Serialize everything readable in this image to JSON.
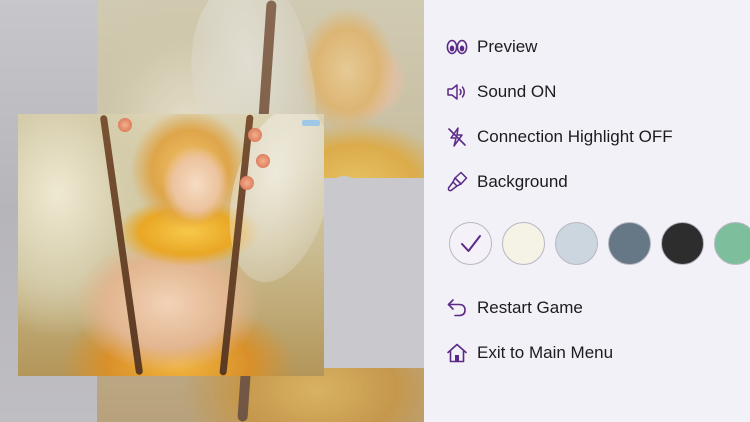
{
  "menu": {
    "preview_label": "Preview",
    "sound_label": "Sound ON",
    "highlight_label": "Connection Highlight OFF",
    "background_label": "Background",
    "restart_label": "Restart Game",
    "exit_label": "Exit to Main Menu"
  },
  "icons": {
    "preview": "eyes-icon",
    "sound": "speaker-icon",
    "highlight": "lightning-off-icon",
    "background": "paint-brush-icon",
    "restart": "back-arrow-icon",
    "exit": "home-icon"
  },
  "background_swatches": [
    {
      "color": "#f4f2f8",
      "selected": true
    },
    {
      "color": "#f5f2e6",
      "selected": false
    },
    {
      "color": "#ccd6de",
      "selected": false
    },
    {
      "color": "#667785",
      "selected": false
    },
    {
      "color": "#2d2d2d",
      "selected": false
    },
    {
      "color": "#7dbf9c",
      "selected": false
    }
  ],
  "colors": {
    "accent": "#5b2a86",
    "menu_background": "#f2f1f7",
    "text": "#1c1c1e"
  }
}
